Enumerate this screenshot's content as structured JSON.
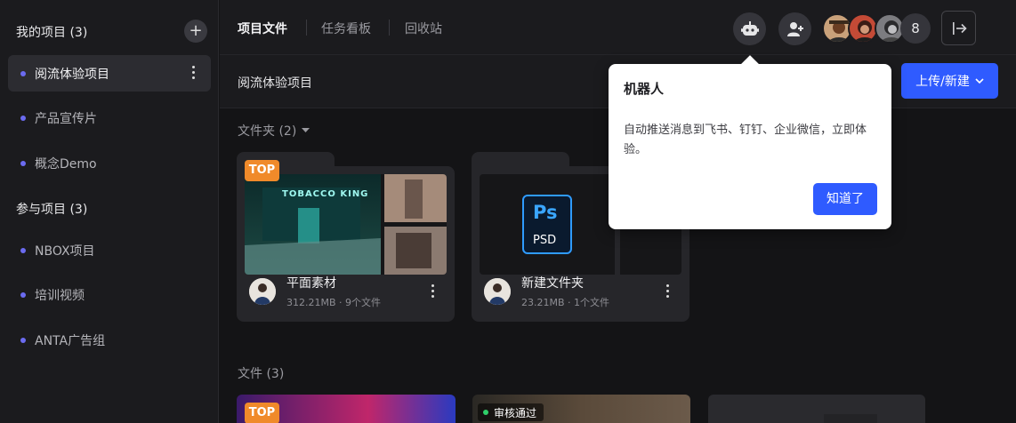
{
  "sidebar": {
    "my_projects_label": "我的项目 (3)",
    "add_symbol": "+",
    "my_projects": [
      {
        "label": "阅流体验项目",
        "active": true
      },
      {
        "label": "产品宣传片",
        "active": false
      },
      {
        "label": "概念Demo",
        "active": false
      }
    ],
    "joined_projects_label": "参与项目 (3)",
    "joined_projects": [
      {
        "label": "NBOX项目"
      },
      {
        "label": "培训视频"
      },
      {
        "label": "ANTA广告组"
      }
    ]
  },
  "header": {
    "tabs": [
      {
        "label": "项目文件",
        "active": true
      },
      {
        "label": "任务看板",
        "active": false
      },
      {
        "label": "回收站",
        "active": false
      }
    ],
    "member_count": "8"
  },
  "subheader": {
    "title": "阅流体验项目",
    "upload_label": "上传/新建"
  },
  "folders_section": {
    "label": "文件夹 (2)",
    "folders": [
      {
        "name": "平面素材",
        "meta": "312.21MB · 9个文件",
        "badge": "TOP",
        "sign_text": "TOBACCO KING"
      },
      {
        "name": "新建文件夹",
        "meta": "23.21MB · 1个文件",
        "psd_label": "PSD",
        "ps_label": "Ps"
      }
    ]
  },
  "files_section": {
    "label": "文件 (3)",
    "badge": "TOP",
    "review_label": "审核通过"
  },
  "popover": {
    "title": "机器人",
    "body": "自动推送消息到飞书、钉钉、企业微信，立即体验。",
    "button": "知道了"
  },
  "colors": {
    "accent": "#2f5bff",
    "top_badge": "#f08a2a",
    "dot": "#6b6bf0"
  }
}
